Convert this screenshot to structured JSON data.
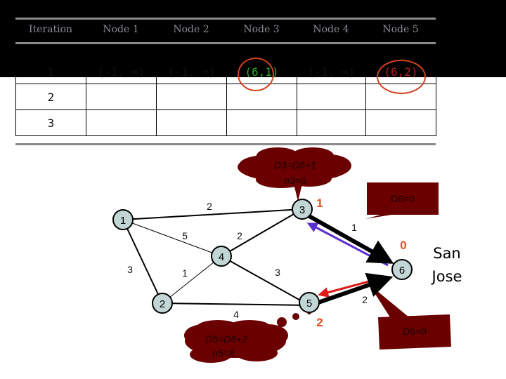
{
  "table": {
    "headers": [
      "Iteration",
      "Node 1",
      "Node 2",
      "Node 3",
      "Node 4",
      "Node 5"
    ],
    "rows": [
      {
        "iteration": "1",
        "cells": [
          "(-1, ∞)",
          "(-1, ∞)",
          "(6,1)",
          "(-1, ∞)",
          "(6,2)"
        ]
      },
      {
        "iteration": "2",
        "cells": [
          "",
          "",
          "",
          "",
          ""
        ]
      },
      {
        "iteration": "3",
        "cells": [
          "",
          "",
          "",
          "",
          ""
        ]
      }
    ],
    "highlight_colors": {
      "node3": "#2aa82a",
      "node5": "#b0202a",
      "circle": "#d2401f"
    }
  },
  "graph": {
    "nodes": [
      {
        "id": "1",
        "label": "1"
      },
      {
        "id": "2",
        "label": "2"
      },
      {
        "id": "3",
        "label": "3"
      },
      {
        "id": "4",
        "label": "4"
      },
      {
        "id": "5",
        "label": "5"
      },
      {
        "id": "6",
        "label": "6"
      }
    ],
    "edges": [
      {
        "from": "1",
        "to": "3",
        "weight": "2"
      },
      {
        "from": "1",
        "to": "4",
        "weight": "5"
      },
      {
        "from": "1",
        "to": "2",
        "weight": "3"
      },
      {
        "from": "2",
        "to": "4",
        "weight": "1"
      },
      {
        "from": "2",
        "to": "5",
        "weight": "4"
      },
      {
        "from": "4",
        "to": "3",
        "weight": "2"
      },
      {
        "from": "4",
        "to": "5",
        "weight": "3"
      },
      {
        "from": "3",
        "to": "6",
        "weight": "1"
      },
      {
        "from": "5",
        "to": "6",
        "weight": "2"
      }
    ],
    "distance_labels": {
      "node3": "1",
      "node5": "2",
      "node6": "0"
    },
    "destination_label_line1": "San",
    "destination_label_line2": "Jose",
    "callouts": {
      "node3_line1": "D3=D6+1",
      "node3_line2": "n3=6",
      "node6_top": "D6=0",
      "node6_bottom": "D6=0",
      "node5_line1": "D5=D6+2",
      "node5_line2": "n5=6"
    },
    "colors": {
      "node_fill": "#c2d6d6",
      "callout_fill": "#6b0000",
      "distance_label": "#e05020",
      "arrow_to_3": "#5a2fd0",
      "arrow_to_5": "#e01818"
    }
  }
}
